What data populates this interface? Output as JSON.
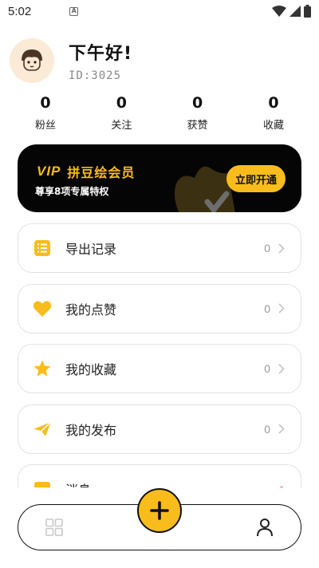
{
  "status_bar": {
    "time": "5:02",
    "notification_glyph": "A"
  },
  "profile": {
    "greeting": "下午好!",
    "id_text": "ID:3025"
  },
  "stats": [
    {
      "value": "0",
      "label": "粉丝"
    },
    {
      "value": "0",
      "label": "关注"
    },
    {
      "value": "0",
      "label": "获赞"
    },
    {
      "value": "0",
      "label": "收藏"
    }
  ],
  "vip": {
    "badge": "VIP",
    "title": "拼豆绘会员",
    "subtitle": "尊享8项专属特权",
    "button": "立即开通"
  },
  "menu": [
    {
      "label": "导出记录",
      "count": "0",
      "icon": "list-icon"
    },
    {
      "label": "我的点赞",
      "count": "0",
      "icon": "heart-icon"
    },
    {
      "label": "我的收藏",
      "count": "0",
      "icon": "star-icon"
    },
    {
      "label": "我的发布",
      "count": "0",
      "icon": "send-icon"
    },
    {
      "label": "消息",
      "count": "",
      "icon": "message-icon"
    }
  ],
  "colors": {
    "accent": "#f8bd1c",
    "vip_bg": "#050505",
    "border": "#e2e2e2"
  }
}
